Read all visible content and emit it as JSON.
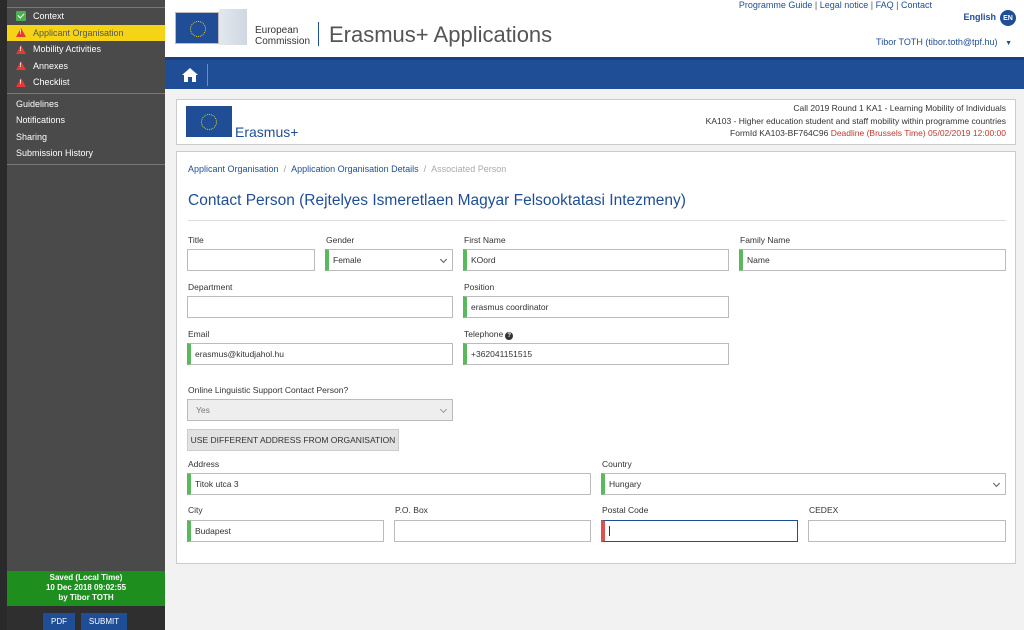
{
  "sidebar": {
    "sections": [
      {
        "label": "Context",
        "icon": "check-icon"
      },
      {
        "label": "Applicant Organisation",
        "icon": "warning-icon",
        "active": true
      },
      {
        "label": "Mobility Activities",
        "icon": "warning-icon"
      },
      {
        "label": "Annexes",
        "icon": "warning-icon"
      },
      {
        "label": "Checklist",
        "icon": "warning-icon"
      }
    ],
    "links": [
      "Guidelines",
      "Notifications",
      "Sharing",
      "Submission History"
    ],
    "saved": {
      "line1": "Saved (Local Time)",
      "line2": "10 Dec 2018 09:02:55",
      "line3": "by Tibor TOTH"
    },
    "pdf_label": "PDF",
    "submit_label": "SUBMIT"
  },
  "header": {
    "ec_line1": "European",
    "ec_line2": "Commission",
    "app_title": "Erasmus+ Applications",
    "links": {
      "guide": "Programme Guide",
      "legal": "Legal notice",
      "faq": "FAQ",
      "contact": "Contact"
    },
    "language": "English",
    "language_code": "EN",
    "user": "Tibor TOTH (tibor.toth@tpf.hu)"
  },
  "call": {
    "programme": "Erasmus+",
    "line1": "Call 2019  Round 1  KA1 - Learning Mobility of Individuals",
    "line2": "KA103 - Higher education student and staff mobility within programme countries",
    "form_id": "FormId KA103-BF764C96",
    "deadline": "Deadline (Brussels Time) 05/02/2019 12:00:00"
  },
  "breadcrumb": {
    "item1": "Applicant Organisation",
    "item2": "Application Organisation Details",
    "item3": "Associated Person"
  },
  "form": {
    "title": "Contact Person (Rejtelyes Ismeretlaen Magyar Felsooktatasi Intezmeny)",
    "title_label": "Title",
    "title_value": "",
    "gender_label": "Gender",
    "gender_value": "Female",
    "first_name_label": "First Name",
    "first_name_value": "KOord",
    "family_name_label": "Family Name",
    "family_name_value": "Name",
    "department_label": "Department",
    "department_value": "",
    "position_label": "Position",
    "position_value": "erasmus coordinator",
    "email_label": "Email",
    "email_value": "erasmus@kitudjahol.hu",
    "telephone_label": "Telephone",
    "telephone_value": "+362041151515",
    "ols_label": "Online Linguistic Support Contact Person?",
    "ols_value": "Yes",
    "address_button": "USE DIFFERENT ADDRESS FROM ORGANISATION",
    "address_label": "Address",
    "address_value": "Titok utca 3",
    "country_label": "Country",
    "country_value": "Hungary",
    "city_label": "City",
    "city_value": "Budapest",
    "pobox_label": "P.O. Box",
    "pobox_value": "",
    "postal_label": "Postal Code",
    "postal_value": "",
    "cedex_label": "CEDEX",
    "cedex_value": ""
  },
  "colors": {
    "brand_blue": "#1f4e96",
    "active_yellow": "#f5d417",
    "valid_green": "#5cb85c",
    "error_red": "#d9534f",
    "saved_green": "#1e8f1e"
  }
}
